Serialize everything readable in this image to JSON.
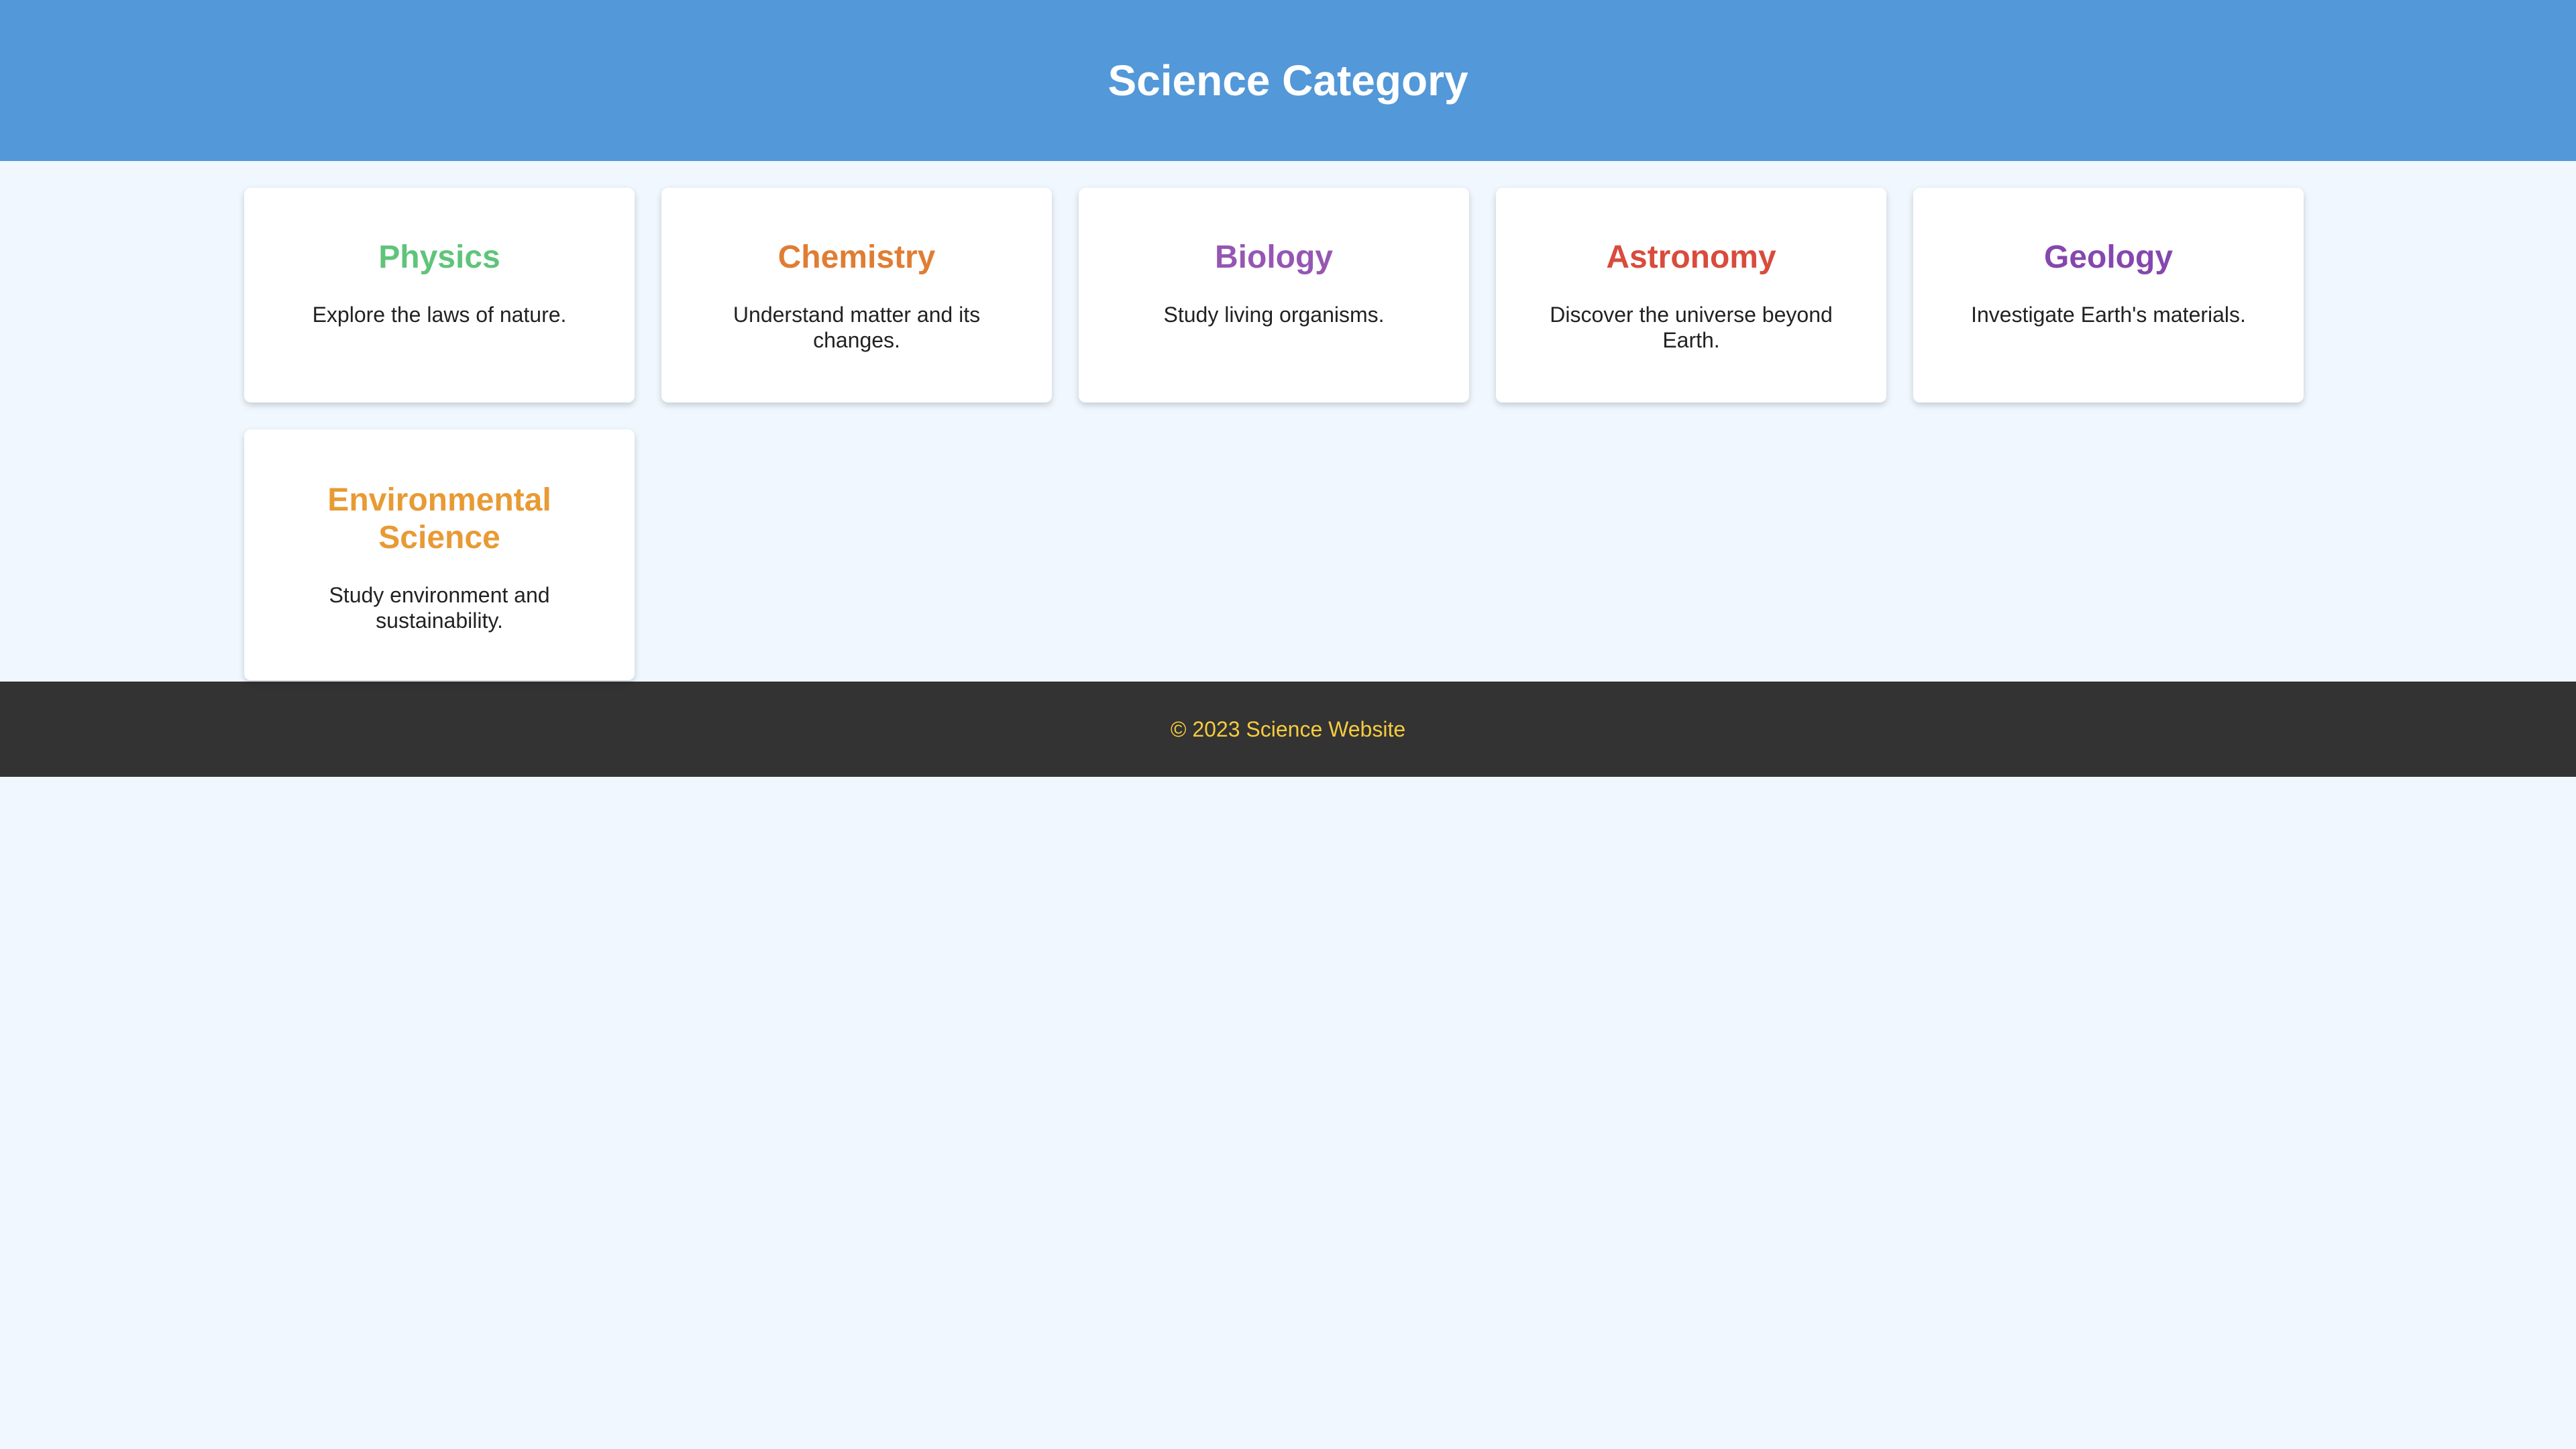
{
  "header": {
    "title": "Science Category"
  },
  "categories": [
    {
      "title": "Physics",
      "description": "Explore the laws of nature.",
      "color": "#5fc47a"
    },
    {
      "title": "Chemistry",
      "description": "Understand matter and its changes.",
      "color": "#e07d33"
    },
    {
      "title": "Biology",
      "description": "Study living organisms.",
      "color": "#9656b3"
    },
    {
      "title": "Astronomy",
      "description": "Discover the universe beyond Earth.",
      "color": "#d94b3c"
    },
    {
      "title": "Geology",
      "description": "Investigate Earth's materials.",
      "color": "#8547ae"
    },
    {
      "title": "Environmental Science",
      "description": "Study environment and sustainability.",
      "color": "#e89a34"
    }
  ],
  "footer": {
    "text": "© 2023 Science Website"
  },
  "colors": {
    "header_bg": "#5398d8",
    "page_bg": "#f0f7ff",
    "footer_bg": "#333333",
    "footer_text": "#f6cb3f"
  }
}
